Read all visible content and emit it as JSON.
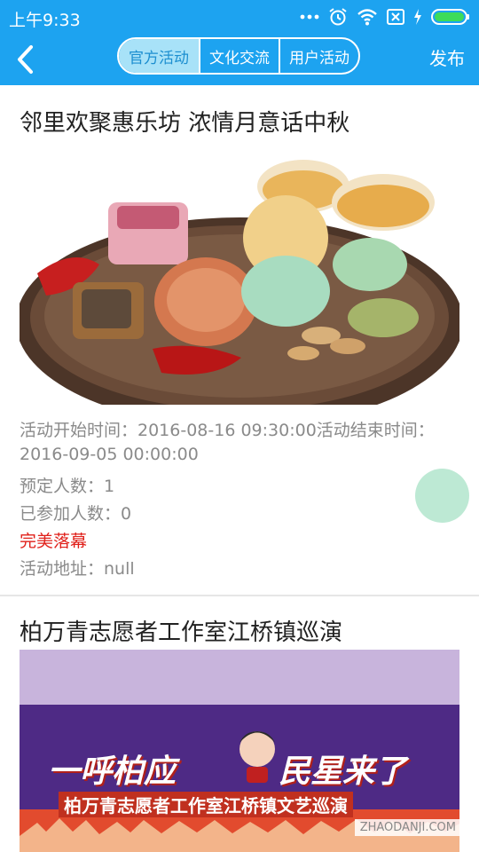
{
  "status_bar": {
    "time": "上午9:33",
    "icons": [
      "more-dots-icon",
      "alarm-icon",
      "wifi-icon",
      "sim-off-icon",
      "charging-icon",
      "battery-icon"
    ]
  },
  "app_bar": {
    "back_icon": "chevron-left-icon",
    "tabs": [
      {
        "label": "官方活动",
        "selected": true
      },
      {
        "label": "文化交流",
        "selected": false
      },
      {
        "label": "用户活动",
        "selected": false
      }
    ],
    "publish_label": "发布"
  },
  "activities": [
    {
      "title": "邻里欢聚惠乐坊 浓情月意话中秋",
      "time_line_1": "活动开始时间：2016-08-16 09:30:00活动结束时间：",
      "time_line_2": "2016-09-05 00:00:00",
      "reserved": "预定人数：1",
      "joined": "已参加人数：0",
      "status": "完美落幕",
      "address": "活动地址：null"
    },
    {
      "title": "柏万青志愿者工作室江桥镇巡演",
      "banner_text_left": "一呼柏应",
      "banner_text_right": "民星来了",
      "banner_subtitle": "柏万青志愿者工作室江桥镇文艺巡演"
    }
  ],
  "watermark": "ZHAODANJI.COM",
  "colors": {
    "primary": "#1da3f0",
    "selected_tab_bg": "#a8e2f8",
    "status_red": "#e0201a",
    "fab": "#bde9d4"
  }
}
